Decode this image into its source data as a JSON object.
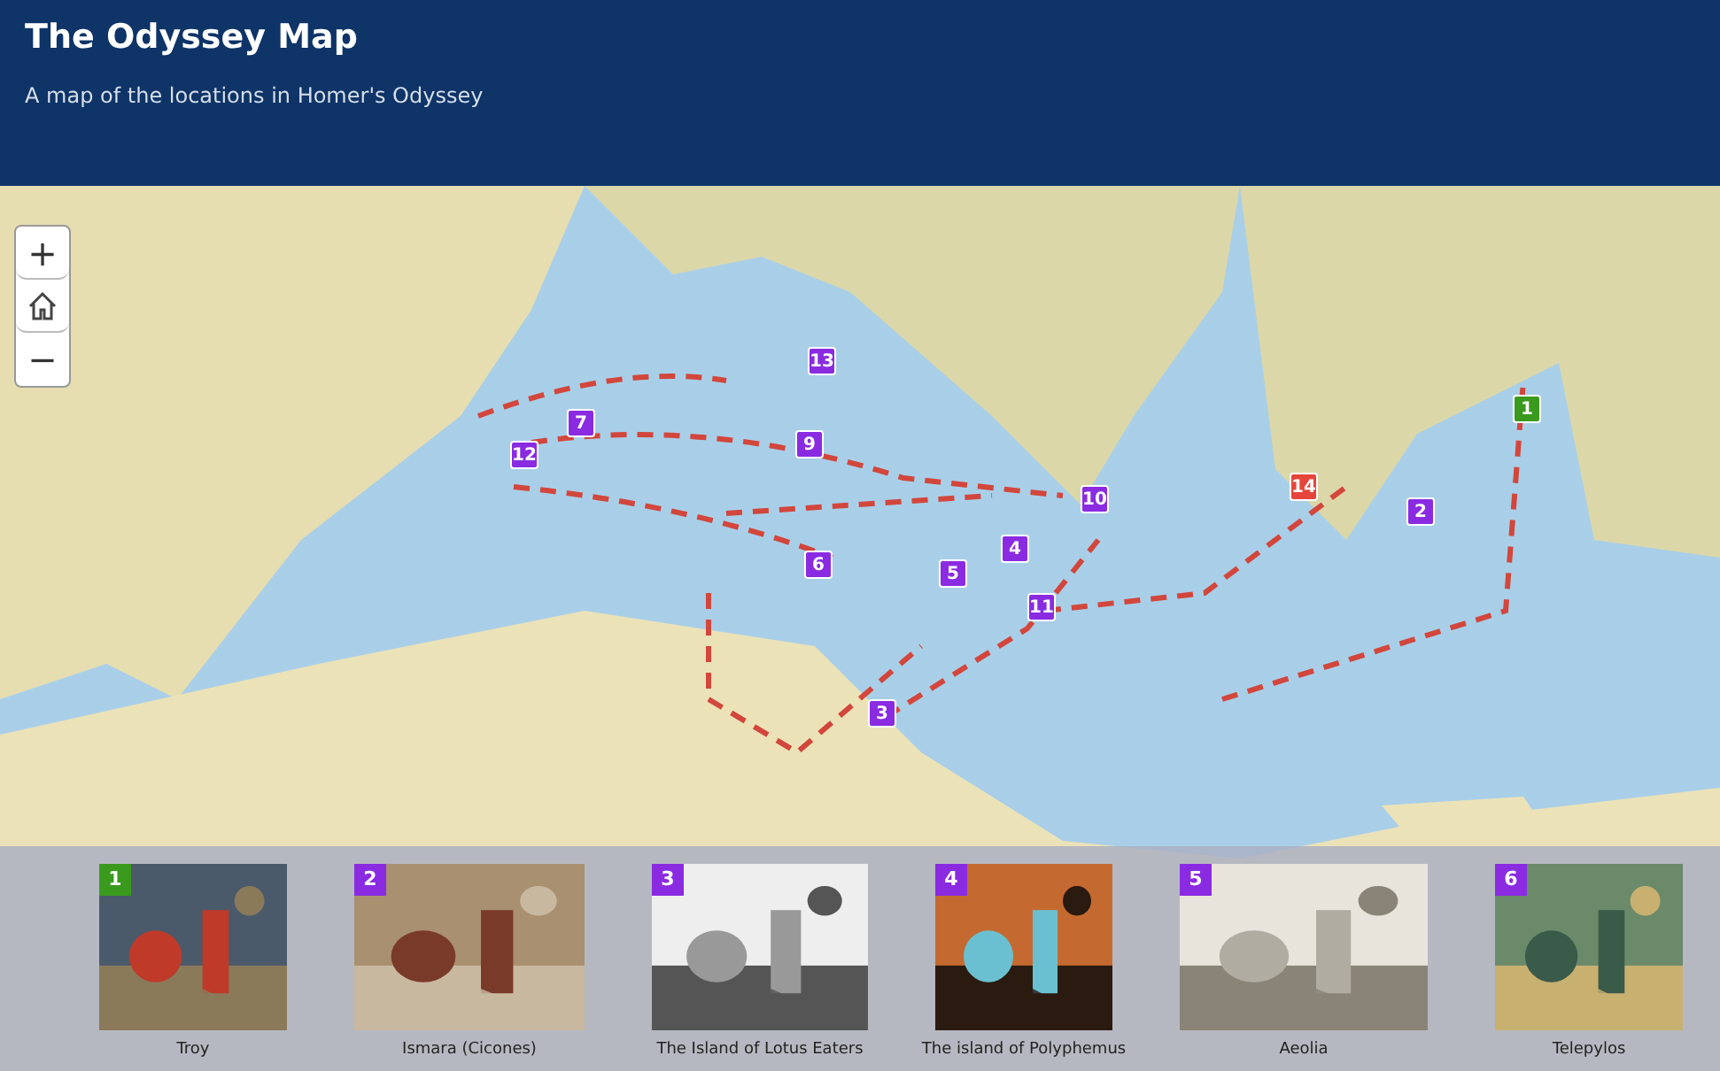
{
  "header": {
    "title": "The Odyssey Map",
    "subtitle": "A map of the locations in Homer's Odyssey"
  },
  "map_controls": [
    {
      "kind": "zoom-in",
      "label": "+"
    },
    {
      "kind": "home"
    },
    {
      "kind": "zoom-out",
      "label": "−"
    }
  ],
  "markers": [
    {
      "number": "1",
      "color": "#3a9a1d"
    },
    {
      "number": "2",
      "color": "#8a2be2"
    },
    {
      "number": "3",
      "color": "#8a2be2"
    },
    {
      "number": "4",
      "color": "#8a2be2"
    },
    {
      "number": "5",
      "color": "#8a2be2"
    },
    {
      "number": "6",
      "color": "#8a2be2"
    },
    {
      "number": "7",
      "color": "#8a2be2"
    },
    {
      "number": "9",
      "color": "#8a2be2"
    },
    {
      "number": "10",
      "color": "#8a2be2"
    },
    {
      "number": "11",
      "color": "#8a2be2"
    },
    {
      "number": "12",
      "color": "#8a2be2"
    },
    {
      "number": "13",
      "color": "#8a2be2"
    },
    {
      "number": "14",
      "color": "#e5453a"
    }
  ],
  "carousel": [
    {
      "number": "1",
      "color": "#3a9a1d",
      "caption": "Troy",
      "kind": "picture"
    },
    {
      "number": "2",
      "color": "#8a2be2",
      "caption": "Ismara (Cicones)",
      "kind": "picture"
    },
    {
      "number": "3",
      "color": "#8a2be2",
      "caption": "The Island of Lotus Eaters",
      "kind": "picture"
    },
    {
      "number": "4",
      "color": "#8a2be2",
      "caption": "The island of Polyphemus",
      "kind": "picture"
    },
    {
      "number": "5",
      "color": "#8a2be2",
      "caption": "Aeolia",
      "kind": "picture"
    },
    {
      "number": "6",
      "color": "#8a2be2",
      "caption": "Telepylos",
      "kind": "picture"
    }
  ]
}
